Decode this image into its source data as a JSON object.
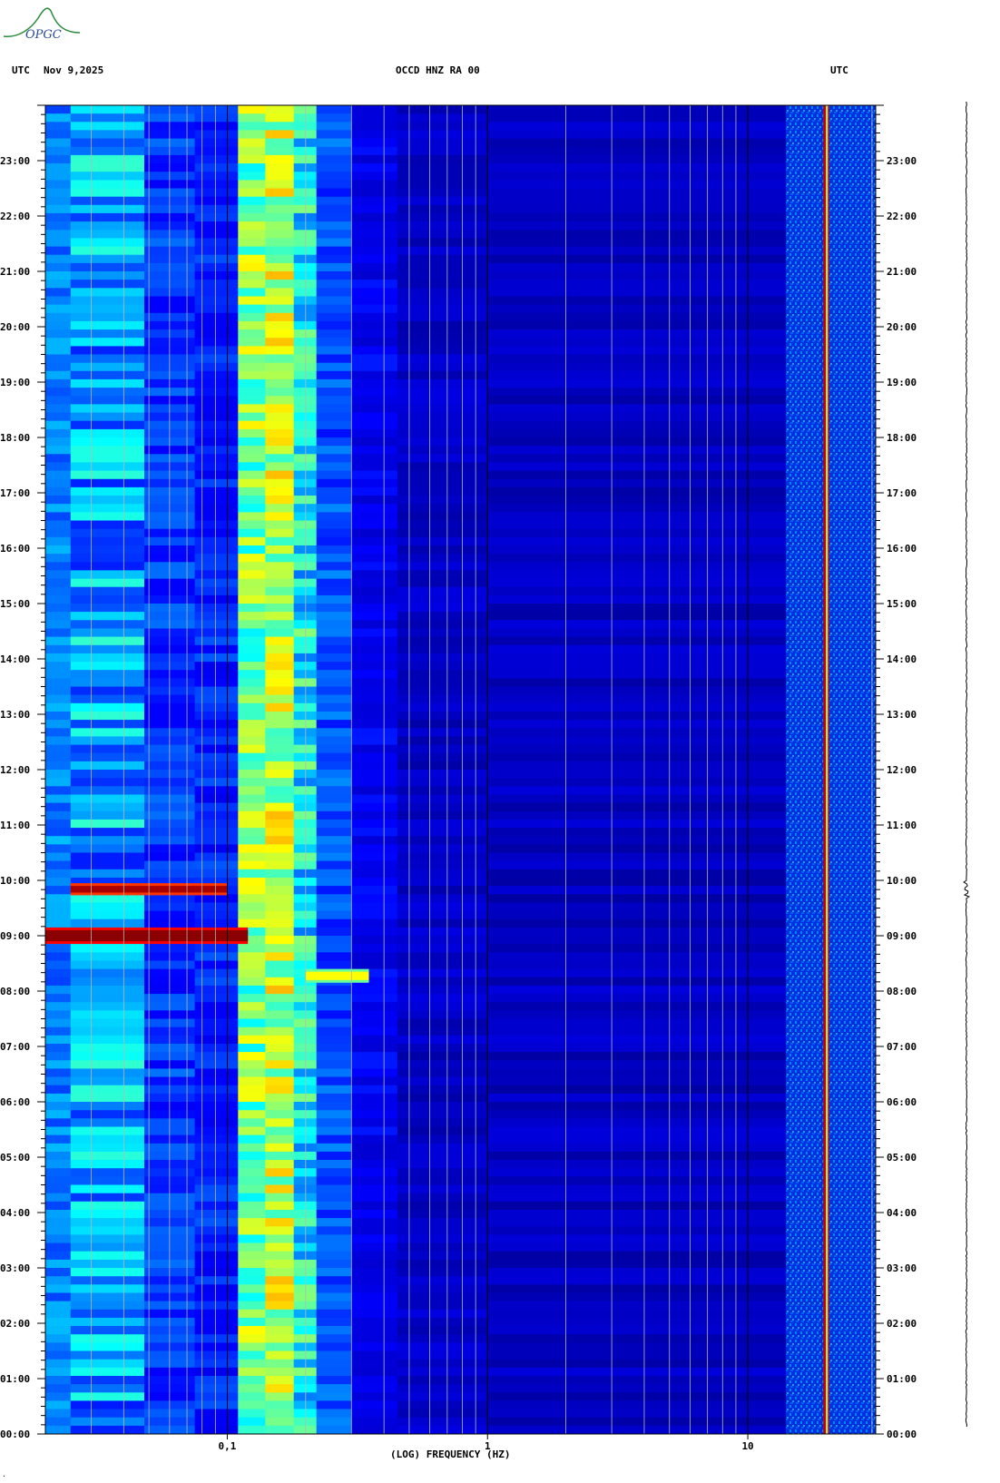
{
  "header": {
    "left_tz": "UTC",
    "date": "Nov 9,2025",
    "station": "OCCD HNZ RA 00",
    "right_tz": "UTC"
  },
  "logo": {
    "text": "OPGC",
    "color": "#2a8a3a"
  },
  "chart_data": {
    "type": "heatmap",
    "title": "OCCD HNZ RA 00",
    "xlabel": "(LOG) FREQUENCY (HZ)",
    "ylabel": "",
    "x_scale": "log",
    "x_range_hz": [
      0.02,
      31
    ],
    "x_tick_labels": [
      {
        "value": 0.1,
        "label": "0,1"
      },
      {
        "value": 1,
        "label": "1"
      },
      {
        "value": 10,
        "label": "10"
      }
    ],
    "y_range_hours": [
      0,
      24
    ],
    "y_tick_labels": [
      "00:00",
      "01:00",
      "02:00",
      "03:00",
      "04:00",
      "05:00",
      "06:00",
      "07:00",
      "08:00",
      "09:00",
      "10:00",
      "11:00",
      "12:00",
      "13:00",
      "14:00",
      "15:00",
      "16:00",
      "17:00",
      "18:00",
      "19:00",
      "20:00",
      "21:00",
      "22:00",
      "23:00"
    ],
    "colormap": [
      "#00008b",
      "#0000ff",
      "#00ffff",
      "#ffff00",
      "#ff0000",
      "#8b0000"
    ],
    "features": [
      {
        "name": "microseism band",
        "freq_hz": [
          0.11,
          0.22
        ],
        "hours": [
          0,
          24
        ],
        "level": 0.5
      },
      {
        "name": "strong event",
        "freq_hz": [
          0.02,
          0.12
        ],
        "hours": [
          8.9,
          9.1
        ],
        "level": 1.0
      },
      {
        "name": "strong event",
        "freq_hz": [
          0.025,
          0.1
        ],
        "hours": [
          9.78,
          9.9
        ],
        "level": 0.95
      },
      {
        "name": "low-frequency phase",
        "freq_hz": [
          0.2,
          0.35
        ],
        "hours": [
          8.2,
          8.35
        ],
        "level": 0.6
      },
      {
        "name": "narrow line",
        "freq_hz": [
          19.5,
          20.5
        ],
        "hours": [
          0,
          24
        ],
        "level": 0.95
      },
      {
        "name": "high-frequency noise",
        "freq_hz": [
          14,
          31
        ],
        "hours": [
          0,
          24
        ],
        "level": 0.55
      }
    ]
  }
}
